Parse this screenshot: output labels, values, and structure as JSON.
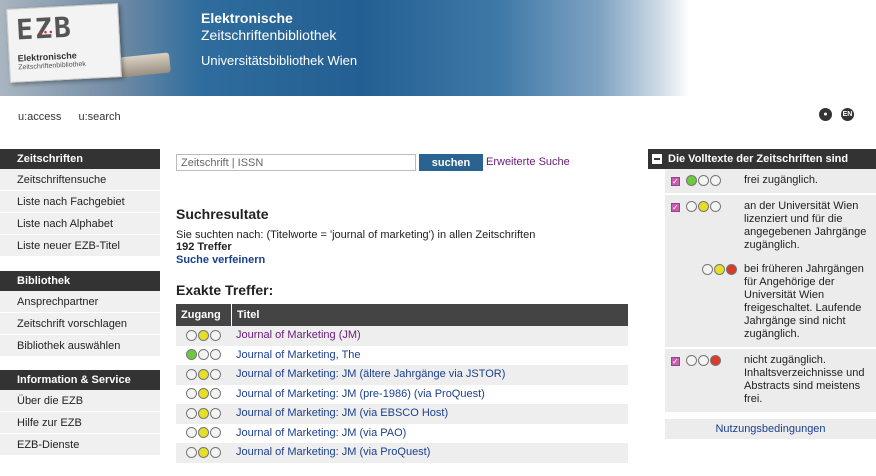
{
  "header": {
    "logo_letters": "EZB",
    "logo_sub1": "Elektronische",
    "logo_sub2": "Zeitschriftenbibliothek",
    "title_line1": "Elektronische",
    "title_line2": "Zeitschriftenbibliothek",
    "institution": "Universitätsbibliothek Wien"
  },
  "topnav": {
    "access": "u:access",
    "search": "u:search",
    "icons": [
      "accessibility-icon",
      "language-en-icon"
    ],
    "lang_label": "EN"
  },
  "sidebar": {
    "sections": [
      {
        "title": "Zeitschriften",
        "items": [
          "Zeitschriftensuche",
          "Liste nach Fachgebiet",
          "Liste nach Alphabet",
          "Liste neuer EZB-Titel"
        ]
      },
      {
        "title": "Bibliothek",
        "items": [
          "Ansprechpartner",
          "Zeitschrift vorschlagen",
          "Bibliothek auswählen"
        ]
      },
      {
        "title": "Information & Service",
        "items": [
          "Über die EZB",
          "Hilfe zur EZB",
          "EZB-Dienste"
        ]
      }
    ]
  },
  "search": {
    "placeholder": "Zeitschrift | ISSN",
    "button": "suchen",
    "advanced": "Erweiterte Suche"
  },
  "results": {
    "heading": "Suchresultate",
    "query": "Sie suchten nach: (Titelworte = 'journal of marketing') in allen Zeitschriften",
    "count": "192 Treffer",
    "refine": "Suche verfeinern",
    "exact_heading": "Exakte Treffer:",
    "col_access": "Zugang",
    "col_title": "Titel",
    "rows": [
      {
        "dots": [
          "#f4f4f4",
          "#e6df2a",
          "#f4f4f4"
        ],
        "title": "Journal of Marketing (JM)",
        "visited": true
      },
      {
        "dots": [
          "#6ccb3c",
          "#f4f4f4",
          "#f4f4f4"
        ],
        "title": "Journal of Marketing, The",
        "visited": false
      },
      {
        "dots": [
          "#f4f4f4",
          "#e6df2a",
          "#f4f4f4"
        ],
        "title": "Journal of Marketing: JM (ältere Jahrgänge via JSTOR)",
        "visited": false
      },
      {
        "dots": [
          "#f4f4f4",
          "#e6df2a",
          "#f4f4f4"
        ],
        "title": "Journal of Marketing: JM (pre-1986) (via ProQuest)",
        "visited": false
      },
      {
        "dots": [
          "#f4f4f4",
          "#e6df2a",
          "#f4f4f4"
        ],
        "title": "Journal of Marketing: JM (via EBSCO Host)",
        "visited": false
      },
      {
        "dots": [
          "#f4f4f4",
          "#e6df2a",
          "#f4f4f4"
        ],
        "title": "Journal of Marketing: JM (via PAO)",
        "visited": false
      },
      {
        "dots": [
          "#f4f4f4",
          "#e6df2a",
          "#f4f4f4"
        ],
        "title": "Journal of Marketing: JM (via ProQuest)",
        "visited": false
      }
    ]
  },
  "legend": {
    "title": "Die Volltexte der Zeitschriften sind",
    "items": [
      {
        "checked": true,
        "dots": [
          "#6ccb3c",
          "#f4f4f4",
          "#f4f4f4"
        ],
        "text": "frei zugänglich."
      },
      {
        "checked": true,
        "dots": [
          "#f4f4f4",
          "#e6df2a",
          "#f4f4f4"
        ],
        "text": "an der Universität Wien lizenziert und für die angegebenen Jahrgänge zugänglich."
      },
      {
        "checked": false,
        "dots": [
          "#f4f4f4",
          "#e6df2a",
          "#d93a2b"
        ],
        "text": "bei früheren Jahrgängen für Angehörige der Universität Wien freigeschaltet. Laufende Jahrgänge sind nicht zugänglich."
      },
      {
        "checked": true,
        "dots": [
          "#f4f4f4",
          "#f4f4f4",
          "#d93a2b"
        ],
        "text": "nicht zugänglich. Inhaltsverzeichnisse und Abstracts sind meistens frei."
      }
    ],
    "terms": "Nutzungsbedingungen"
  }
}
